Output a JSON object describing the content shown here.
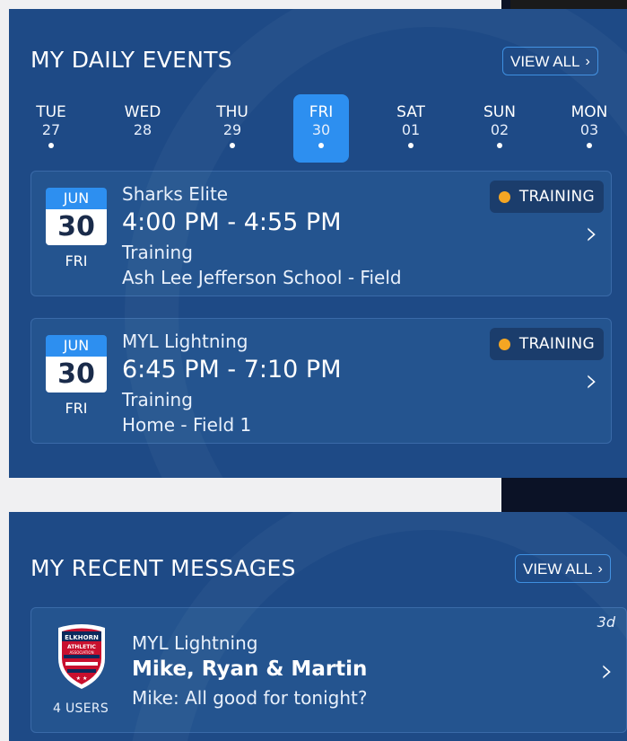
{
  "events_panel": {
    "title": "MY DAILY EVENTS",
    "view_all_label": "VIEW ALL",
    "days": [
      {
        "dow": "TUE",
        "num": "27",
        "has_events": true,
        "selected": false
      },
      {
        "dow": "WED",
        "num": "28",
        "has_events": false,
        "selected": false
      },
      {
        "dow": "THU",
        "num": "29",
        "has_events": true,
        "selected": false
      },
      {
        "dow": "FRI",
        "num": "30",
        "has_events": true,
        "selected": true
      },
      {
        "dow": "SAT",
        "num": "01",
        "has_events": true,
        "selected": false
      },
      {
        "dow": "SUN",
        "num": "02",
        "has_events": true,
        "selected": false
      },
      {
        "dow": "MON",
        "num": "03",
        "has_events": true,
        "selected": false
      }
    ],
    "events": [
      {
        "month": "JUN",
        "day": "30",
        "weekday": "FRI",
        "team": "Sharks Elite",
        "time": "4:00 PM - 4:55 PM",
        "type": "Training",
        "location": "Ash Lee Jefferson School - Field",
        "tag": "TRAINING"
      },
      {
        "month": "JUN",
        "day": "30",
        "weekday": "FRI",
        "team": "MYL Lightning",
        "time": "6:45 PM - 7:10 PM",
        "type": "Training",
        "location": "Home - Field 1",
        "tag": "TRAINING"
      }
    ]
  },
  "messages_panel": {
    "title": "MY RECENT MESSAGES",
    "view_all_label": "VIEW ALL",
    "messages": [
      {
        "crest_text_top": "ELKHORN",
        "crest_text_middle": "ATHLETIC",
        "crest_text_bottom": "ASSOCIATION",
        "users_label": "4 USERS",
        "team": "MYL Lightning",
        "participants": "Mike, Ryan & Martin",
        "preview": "Mike: All good for tonight?",
        "age": "3d"
      }
    ]
  },
  "icons": {
    "chevron": "chevron-right-icon",
    "tag_dot": "status-dot-icon"
  },
  "colors": {
    "panel_bg": "#1e4a86",
    "card_bg": "#24548f",
    "accent_blue": "#2d8ff0",
    "training_dot": "#f5a623"
  }
}
